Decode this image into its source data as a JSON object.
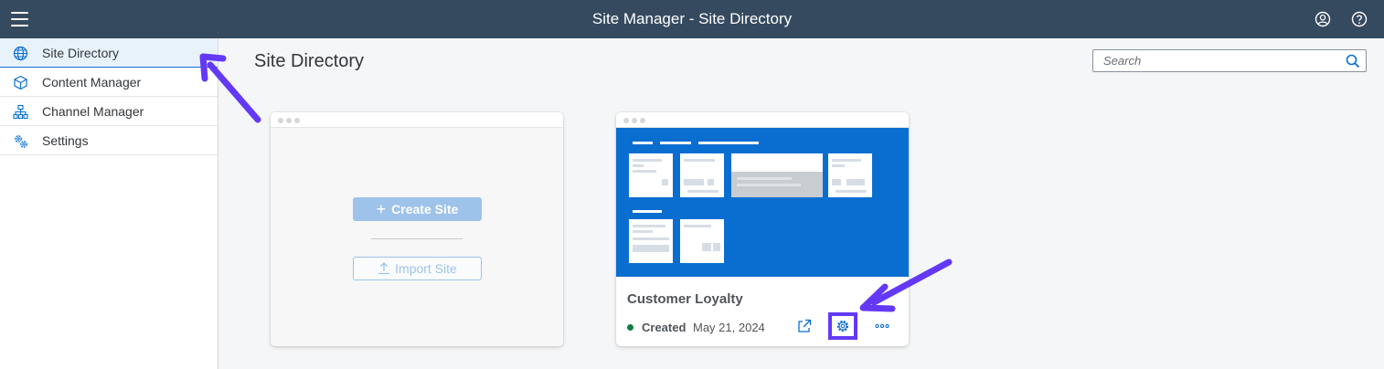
{
  "header": {
    "title": "Site Manager - Site Directory",
    "menu_icon": "hamburger-menu-icon",
    "user_icon": "user-profile-icon",
    "help_icon": "help-icon",
    "background_color": "#354a5f"
  },
  "sidebar": {
    "items": [
      {
        "label": "Site Directory",
        "icon": "globe-icon",
        "selected": true
      },
      {
        "label": "Content Manager",
        "icon": "cube-icon",
        "selected": false
      },
      {
        "label": "Channel Manager",
        "icon": "hierarchy-icon",
        "selected": false
      },
      {
        "label": "Settings",
        "icon": "gears-icon",
        "selected": false
      }
    ]
  },
  "main": {
    "title": "Site Directory",
    "search": {
      "placeholder": "Search",
      "value": ""
    }
  },
  "create_card": {
    "create_label": "Create Site",
    "import_label": "Import Site"
  },
  "site_card": {
    "name": "Customer Loyalty",
    "status": "Created",
    "status_color": "#107e3e",
    "date": "May 21, 2024",
    "preview_color": "#0a6ed1",
    "actions": [
      "open-external-icon",
      "settings-gear-icon",
      "more-options-icon"
    ]
  },
  "annotations": {
    "arrow_color": "#6339f5"
  }
}
